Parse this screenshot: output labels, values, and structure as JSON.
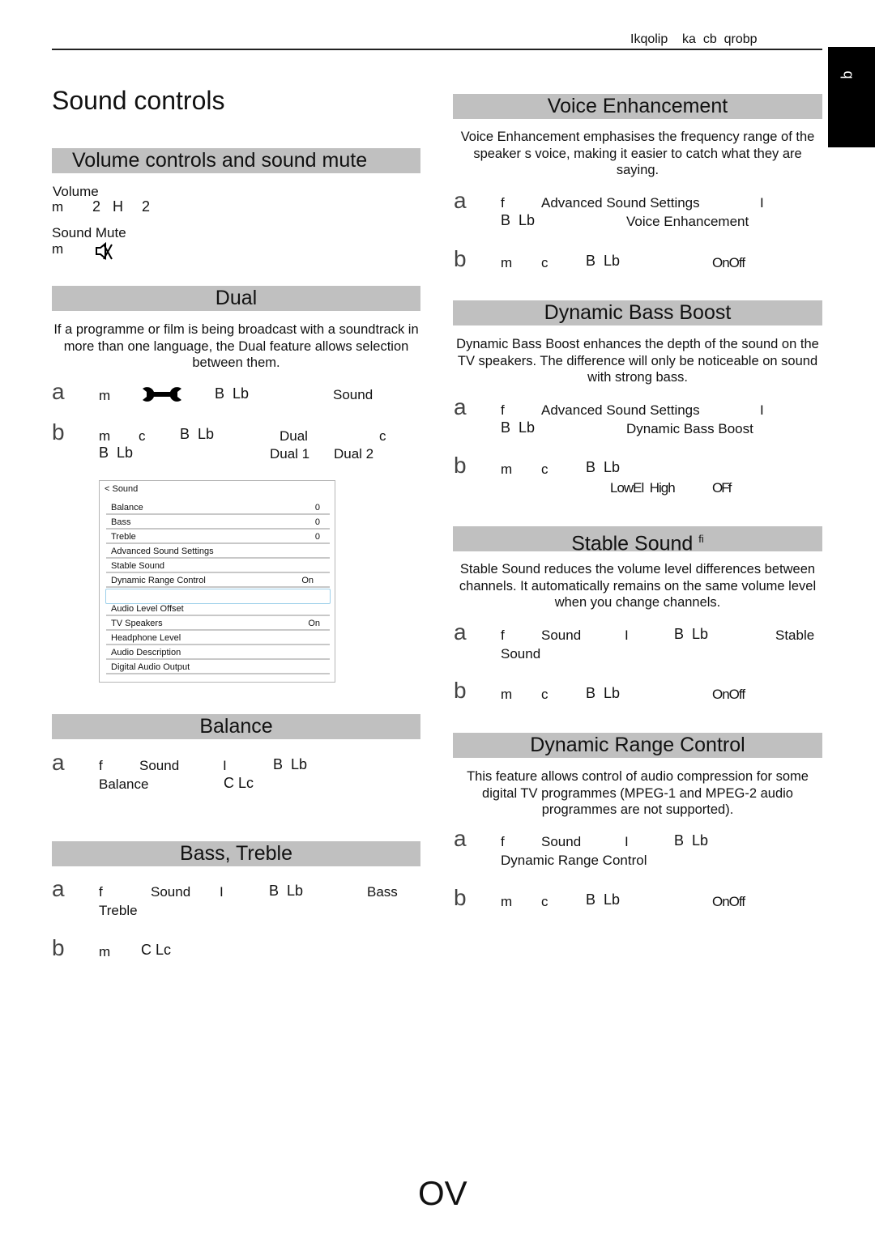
{
  "header": {
    "running_title": "Ikqolip    ka  cb  qrobp",
    "side_tab": "q"
  },
  "page_title": "Sound controls",
  "page_number": "OV",
  "sections": {
    "volume": {
      "title": "Volume controls and sound mute",
      "volume_label": "Volume",
      "volume_line": [
        "m",
        "2",
        "H",
        "2"
      ],
      "mute_label": "Sound Mute",
      "mute_line": [
        "m"
      ],
      "mute_icon": "speaker-mute-icon"
    },
    "dual": {
      "title": "Dual",
      "description": "If a programme or film is being broadcast with a soundtrack in more than one language, the Dual feature allows selection between them.",
      "step_a": {
        "letter": "a",
        "tokens": [
          "m",
          "B  Lb",
          "Sound"
        ],
        "icon": "wrench-icon"
      },
      "step_b": {
        "letter": "b",
        "tokens": [
          "m",
          "c",
          "B  Lb",
          "Dual",
          "c",
          "B  Lb",
          "Dual 1",
          "Dual 2"
        ]
      }
    },
    "sound_menu": {
      "title": "< Sound",
      "rows": [
        {
          "label": "Balance",
          "value": "0"
        },
        {
          "label": "Bass",
          "value": "0"
        },
        {
          "label": "Treble",
          "value": "0"
        },
        {
          "label": "Advanced Sound Settings",
          "value": ""
        },
        {
          "label": "Stable Sound",
          "value": ""
        },
        {
          "label": "Dynamic Range Control",
          "value": "On"
        },
        {
          "label": "",
          "value": ""
        },
        {
          "label": "Audio Level Offset",
          "value": ""
        },
        {
          "label": "TV Speakers",
          "value": "On"
        },
        {
          "label": "Headphone Level",
          "value": ""
        },
        {
          "label": "Audio Description",
          "value": ""
        },
        {
          "label": "Digital Audio Output",
          "value": ""
        }
      ]
    },
    "balance": {
      "title": "Balance",
      "step_a": {
        "letter": "a",
        "tokens": [
          "f",
          "Sound",
          "I",
          "B  Lb",
          "Balance",
          "C Lc"
        ]
      }
    },
    "bass_treble": {
      "title": "Bass, Treble",
      "step_a": {
        "letter": "a",
        "tokens": [
          "f",
          "Sound",
          "I",
          "B  Lb",
          "Bass",
          "Treble"
        ]
      },
      "step_b": {
        "letter": "b",
        "tokens": [
          "m",
          "C Lc"
        ]
      }
    },
    "voice": {
      "title": "Voice Enhancement",
      "description": "Voice Enhancement   emphasises the frequency range of the speaker s voice, making it easier to catch what they are saying.",
      "step_a": {
        "letter": "a",
        "tokens": [
          "f",
          "Advanced Sound Settings",
          "I",
          "B  Lb",
          "Voice Enhancement"
        ]
      },
      "step_b": {
        "letter": "b",
        "tokens": [
          "m",
          "c",
          "B  Lb",
          "OnOff"
        ]
      }
    },
    "bass_boost": {
      "title": "Dynamic Bass Boost",
      "description": "Dynamic Bass Boost    enhances the depth of the sound on the TV speakers. The difference will only be noticeable on sound with strong bass.",
      "step_a": {
        "letter": "a",
        "tokens": [
          "f",
          "Advanced Sound Settings",
          "I",
          "B  Lb",
          "Dynamic Bass Boost"
        ]
      },
      "step_b": {
        "letter": "b",
        "tokens": [
          "m",
          "c",
          "B  Lb",
          "LowEl  High",
          "OFf"
        ]
      }
    },
    "stable": {
      "title": "Stable Sound",
      "title_suffix": "fi",
      "description": "Stable Sound   reduces the volume level differences between channels. It automatically remains on the same volume level when you change channels.",
      "step_a": {
        "letter": "a",
        "tokens": [
          "f",
          "Sound",
          "I",
          "B  Lb",
          "Stable",
          "Sound"
        ]
      },
      "step_b": {
        "letter": "b",
        "tokens": [
          "m",
          "c",
          "B  Lb",
          "OnOff"
        ]
      }
    },
    "drc": {
      "title": "Dynamic Range Control",
      "description": "This feature allows control of audio compression for some digital TV programmes (MPEG-1 and MPEG-2 audio programmes are not supported).",
      "step_a": {
        "letter": "a",
        "tokens": [
          "f",
          "Sound",
          "I",
          "B  Lb",
          "Dynamic Range Control"
        ]
      },
      "step_b": {
        "letter": "b",
        "tokens": [
          "m",
          "c",
          "B  Lb",
          "OnOff"
        ]
      }
    }
  }
}
